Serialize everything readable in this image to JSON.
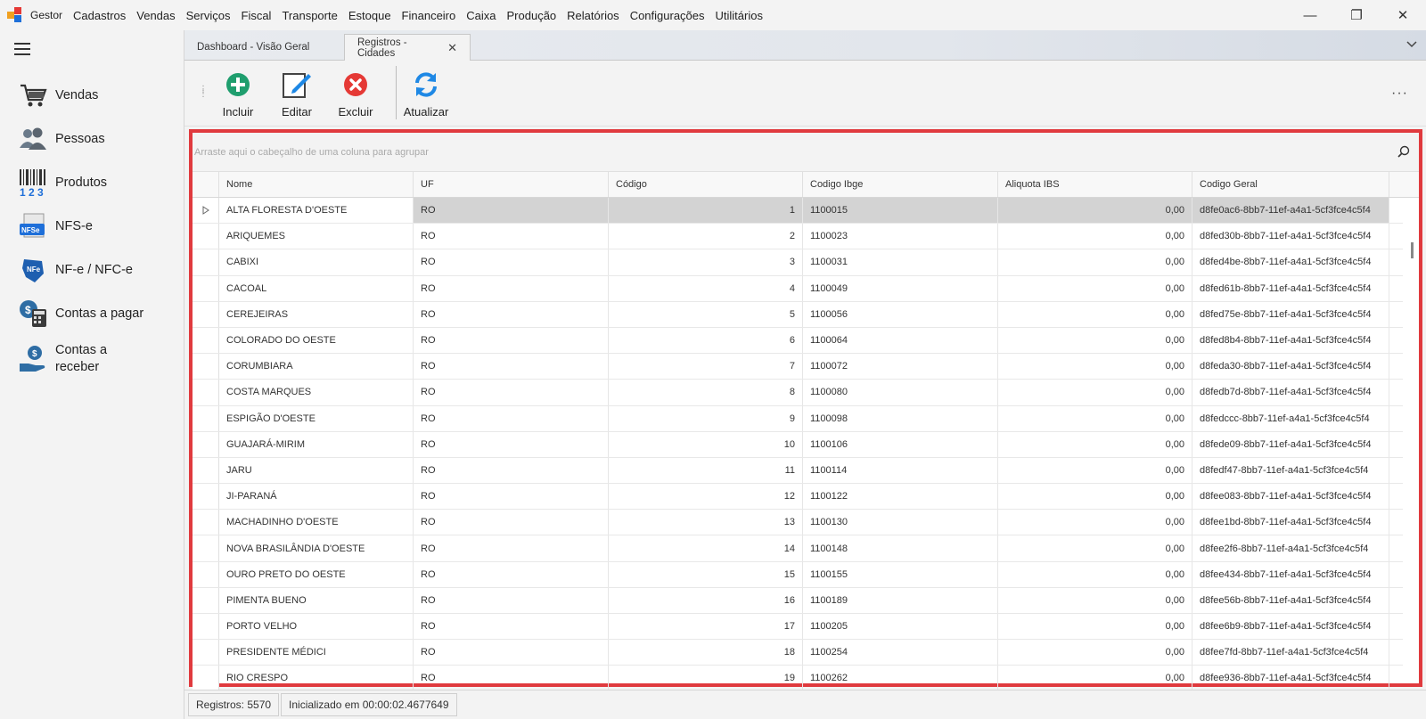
{
  "menubar": {
    "items": [
      "Gestor",
      "Cadastros",
      "Vendas",
      "Serviços",
      "Fiscal",
      "Transporte",
      "Estoque",
      "Financeiro",
      "Caixa",
      "Produção",
      "Relatórios",
      "Configurações",
      "Utilitários"
    ],
    "window_controls": {
      "minimize": "—",
      "restore": "❐",
      "close": "✕"
    }
  },
  "sidebar": {
    "items": [
      {
        "label": "Vendas",
        "icon": "cart-icon"
      },
      {
        "label": "Pessoas",
        "icon": "people-icon"
      },
      {
        "label": "Produtos",
        "icon": "barcode-icon"
      },
      {
        "label": "NFS-e",
        "icon": "nfse-icon"
      },
      {
        "label": "NF-e / NFC-e",
        "icon": "nfe-icon"
      },
      {
        "label": "Contas a pagar",
        "icon": "calculator-money-icon"
      },
      {
        "label": "Contas a\nreceber",
        "icon": "hand-money-icon"
      }
    ]
  },
  "tabs": [
    {
      "label": "Dashboard - Visão Geral",
      "active": false
    },
    {
      "label": "Registros - Cidades",
      "active": true,
      "close": "✕"
    }
  ],
  "toolbar": {
    "incluir": "Incluir",
    "editar": "Editar",
    "excluir": "Excluir",
    "atualizar": "Atualizar",
    "more": "···"
  },
  "grid": {
    "group_panel_placeholder": "Arraste aqui o cabeçalho de uma coluna para agrupar",
    "columns": [
      "Nome",
      "UF",
      "Código",
      "Codigo Ibge",
      "Aliquota IBS",
      "Codigo Geral"
    ],
    "rows": [
      [
        "ALTA FLORESTA D'OESTE",
        "RO",
        "1",
        "1100015",
        "0,00",
        "d8fe0ac6-8bb7-11ef-a4a1-5cf3fce4c5f4"
      ],
      [
        "ARIQUEMES",
        "RO",
        "2",
        "1100023",
        "0,00",
        "d8fed30b-8bb7-11ef-a4a1-5cf3fce4c5f4"
      ],
      [
        "CABIXI",
        "RO",
        "3",
        "1100031",
        "0,00",
        "d8fed4be-8bb7-11ef-a4a1-5cf3fce4c5f4"
      ],
      [
        "CACOAL",
        "RO",
        "4",
        "1100049",
        "0,00",
        "d8fed61b-8bb7-11ef-a4a1-5cf3fce4c5f4"
      ],
      [
        "CEREJEIRAS",
        "RO",
        "5",
        "1100056",
        "0,00",
        "d8fed75e-8bb7-11ef-a4a1-5cf3fce4c5f4"
      ],
      [
        "COLORADO DO OESTE",
        "RO",
        "6",
        "1100064",
        "0,00",
        "d8fed8b4-8bb7-11ef-a4a1-5cf3fce4c5f4"
      ],
      [
        "CORUMBIARA",
        "RO",
        "7",
        "1100072",
        "0,00",
        "d8feda30-8bb7-11ef-a4a1-5cf3fce4c5f4"
      ],
      [
        "COSTA MARQUES",
        "RO",
        "8",
        "1100080",
        "0,00",
        "d8fedb7d-8bb7-11ef-a4a1-5cf3fce4c5f4"
      ],
      [
        "ESPIGÃO D'OESTE",
        "RO",
        "9",
        "1100098",
        "0,00",
        "d8fedccc-8bb7-11ef-a4a1-5cf3fce4c5f4"
      ],
      [
        "GUAJARÁ-MIRIM",
        "RO",
        "10",
        "1100106",
        "0,00",
        "d8fede09-8bb7-11ef-a4a1-5cf3fce4c5f4"
      ],
      [
        "JARU",
        "RO",
        "11",
        "1100114",
        "0,00",
        "d8fedf47-8bb7-11ef-a4a1-5cf3fce4c5f4"
      ],
      [
        "JI-PARANÁ",
        "RO",
        "12",
        "1100122",
        "0,00",
        "d8fee083-8bb7-11ef-a4a1-5cf3fce4c5f4"
      ],
      [
        "MACHADINHO D'OESTE",
        "RO",
        "13",
        "1100130",
        "0,00",
        "d8fee1bd-8bb7-11ef-a4a1-5cf3fce4c5f4"
      ],
      [
        "NOVA BRASILÂNDIA D'OESTE",
        "RO",
        "14",
        "1100148",
        "0,00",
        "d8fee2f6-8bb7-11ef-a4a1-5cf3fce4c5f4"
      ],
      [
        "OURO PRETO DO OESTE",
        "RO",
        "15",
        "1100155",
        "0,00",
        "d8fee434-8bb7-11ef-a4a1-5cf3fce4c5f4"
      ],
      [
        "PIMENTA BUENO",
        "RO",
        "16",
        "1100189",
        "0,00",
        "d8fee56b-8bb7-11ef-a4a1-5cf3fce4c5f4"
      ],
      [
        "PORTO VELHO",
        "RO",
        "17",
        "1100205",
        "0,00",
        "d8fee6b9-8bb7-11ef-a4a1-5cf3fce4c5f4"
      ],
      [
        "PRESIDENTE MÉDICI",
        "RO",
        "18",
        "1100254",
        "0,00",
        "d8fee7fd-8bb7-11ef-a4a1-5cf3fce4c5f4"
      ],
      [
        "RIO CRESPO",
        "RO",
        "19",
        "1100262",
        "0,00",
        "d8fee936-8bb7-11ef-a4a1-5cf3fce4c5f4"
      ]
    ]
  },
  "status": {
    "registros": "Registros: 5570",
    "inicializado": "Inicializado em 00:00:02.4677649"
  },
  "colors": {
    "highlight_border": "#e03a3e",
    "add_green": "#1f9e6e",
    "delete_red": "#e53935",
    "refresh_blue": "#1e88e5",
    "selected_row": "#d3d3d3"
  }
}
